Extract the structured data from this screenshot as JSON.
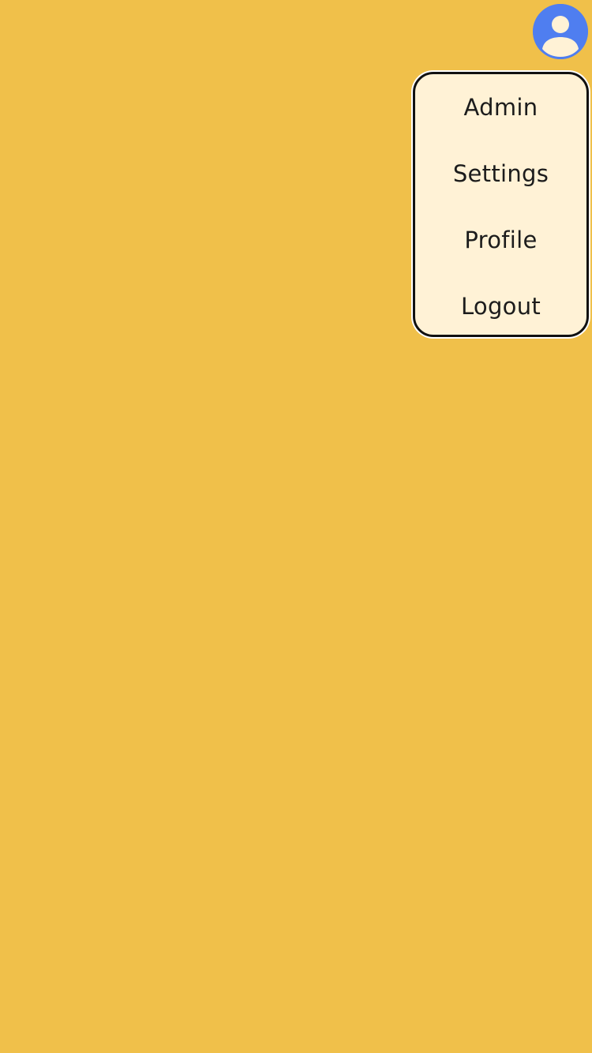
{
  "avatar": {
    "icon": "user-avatar-icon",
    "color": "#4F7EF0"
  },
  "menu": {
    "items": [
      {
        "label": "Admin"
      },
      {
        "label": "Settings"
      },
      {
        "label": "Profile"
      },
      {
        "label": "Logout"
      }
    ]
  },
  "colors": {
    "background": "#F0C04A",
    "menu_background": "#FFF2D6",
    "menu_border": "#111111",
    "text": "#1C1C1C"
  }
}
